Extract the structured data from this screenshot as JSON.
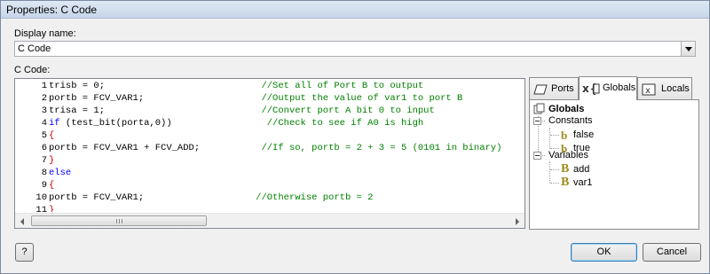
{
  "window": {
    "title": "Properties: C Code"
  },
  "display_name": {
    "label": "Display name:",
    "value": "C Code"
  },
  "code_section": {
    "label": "C Code:"
  },
  "code_lines": [
    {
      "n": "1",
      "parts": [
        [
          "",
          "trisb = 0;                            "
        ],
        [
          "cm",
          "//Set all of Port B to output"
        ]
      ]
    },
    {
      "n": "2",
      "parts": [
        [
          "",
          "portb = FCV_VAR1;                     "
        ],
        [
          "cm",
          "//Output the value of var1 to port B"
        ]
      ]
    },
    {
      "n": "3",
      "parts": [
        [
          "",
          "trisa = 1;                            "
        ],
        [
          "cm",
          "//Convert port A bit 0 to input"
        ]
      ]
    },
    {
      "n": "4",
      "parts": [
        [
          "k",
          "if"
        ],
        [
          "",
          " (test_bit(porta,0))                 "
        ],
        [
          "cm",
          "//Check to see if A0 is high"
        ]
      ]
    },
    {
      "n": "5",
      "parts": [
        [
          "br",
          "{"
        ]
      ]
    },
    {
      "n": "6",
      "parts": [
        [
          "",
          "portb = FCV_VAR1 + FCV_ADD;           "
        ],
        [
          "cm",
          "//If so, portb = 2 + 3 = 5 (0101 in binary)"
        ]
      ]
    },
    {
      "n": "7",
      "parts": [
        [
          "br",
          "}"
        ]
      ]
    },
    {
      "n": "8",
      "parts": [
        [
          "k",
          "else"
        ]
      ]
    },
    {
      "n": "9",
      "parts": [
        [
          "br",
          "{"
        ]
      ]
    },
    {
      "n": "10",
      "parts": [
        [
          "",
          "portb = FCV_VAR1;                    "
        ],
        [
          "cm",
          "//Otherwise portb = 2"
        ]
      ]
    },
    {
      "n": "11",
      "parts": [
        [
          "br",
          "}"
        ]
      ]
    }
  ],
  "colors": {
    "keyword": "#0000ff",
    "brace": "#c00000",
    "comment": "#008000",
    "variable_icon": "#a08a1c"
  },
  "tabs": [
    {
      "label": "Ports",
      "icon": "ports-icon"
    },
    {
      "label": "Globals",
      "icon": "globals-icon",
      "active": true
    },
    {
      "label": "Locals",
      "icon": "locals-icon"
    }
  ],
  "tree": {
    "root": "Globals",
    "constants_label": "Constants",
    "constants": [
      "false",
      "true"
    ],
    "variables_label": "Variables",
    "variables": [
      "add",
      "var1"
    ]
  },
  "buttons": {
    "help": "?",
    "ok": "OK",
    "cancel": "Cancel"
  }
}
